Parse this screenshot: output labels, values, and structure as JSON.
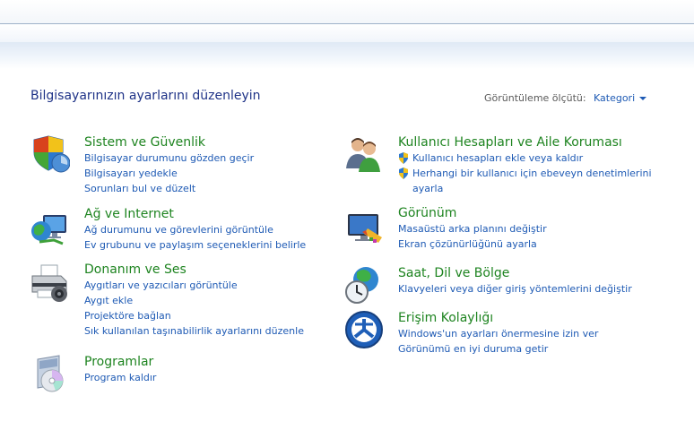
{
  "header": {
    "title": "Bilgisayarınızın ayarlarını düzenleyin",
    "view_label": "Görüntüleme ölçütü:",
    "view_value": "Kategori"
  },
  "categories": {
    "system": {
      "title": "Sistem ve Güvenlik",
      "icon": "shield-security-icon",
      "links": [
        "Bilgisayar durumunu gözden geçir",
        "Bilgisayarı yedekle",
        "Sorunları bul ve düzelt"
      ]
    },
    "network": {
      "title": "Ağ ve Internet",
      "icon": "network-globe-icon",
      "links": [
        "Ağ durumunu ve görevlerini görüntüle",
        "Ev grubunu ve paylaşım seçeneklerini belirle"
      ]
    },
    "hardware": {
      "title": "Donanım ve Ses",
      "icon": "printer-icon",
      "links": [
        "Aygıtları ve yazıcıları görüntüle",
        "Aygıt ekle",
        "Projektöre bağlan",
        "Sık kullanılan taşınabilirlik ayarlarını düzenle"
      ]
    },
    "programs": {
      "title": "Programlar",
      "icon": "programs-disc-icon",
      "links": [
        "Program kaldır"
      ]
    },
    "users": {
      "title": "Kullanıcı Hesapları ve Aile Koruması",
      "icon": "users-icon",
      "links": [
        "Kullanıcı hesapları ekle veya kaldır",
        "Herhangi bir kullanıcı için ebeveyn denetimlerini",
        "ayarla"
      ]
    },
    "appearance": {
      "title": "Görünüm",
      "icon": "monitor-appearance-icon",
      "links": [
        "Masaüstü arka planını değiştir",
        "Ekran çözünürlüğünü ayarla"
      ]
    },
    "clock": {
      "title": "Saat, Dil ve Bölge",
      "icon": "clock-globe-icon",
      "links": [
        "Klavyeleri veya diğer giriş yöntemlerini değiştir"
      ]
    },
    "access": {
      "title": "Erişim Kolaylığı",
      "icon": "ease-of-access-icon",
      "links": [
        "Windows'un ayarları önermesine izin ver",
        "Görünümü en iyi duruma getir"
      ]
    }
  },
  "colors": {
    "title_blue": "#1e3287",
    "category_green": "#1e8420",
    "link_blue": "#1e5ab4"
  }
}
